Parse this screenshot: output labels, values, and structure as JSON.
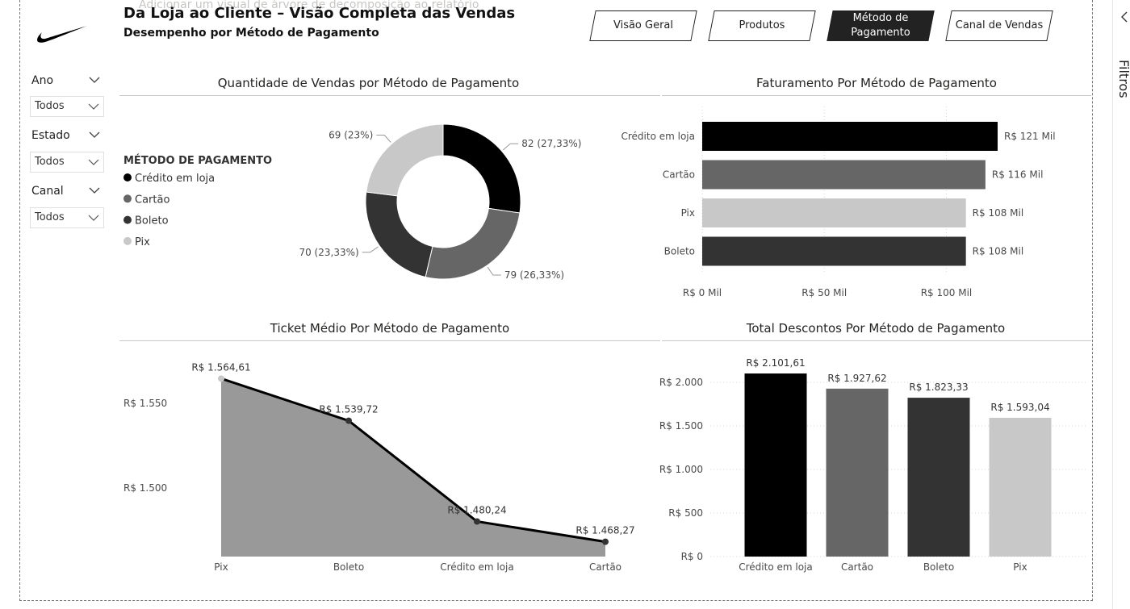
{
  "header": {
    "title": "Da Loja ao Cliente – Visão Completa das Vendas",
    "subtitle": "Desempenho por Método de Pagamento",
    "ghost_hint": "Adicionar um visual de árvore de decomposição ao relatório"
  },
  "nav": {
    "buttons": [
      {
        "label": "Visão Geral",
        "active": false
      },
      {
        "label": "Produtos",
        "active": false
      },
      {
        "label": "Método de Pagamento",
        "active": true
      },
      {
        "label": "Canal de Vendas",
        "active": false
      }
    ]
  },
  "slicers": [
    {
      "title": "Ano",
      "value": "Todos"
    },
    {
      "title": "Estado",
      "value": "Todos"
    },
    {
      "title": "Canal",
      "value": "Todos"
    }
  ],
  "filters_pane": {
    "label": "Filtros"
  },
  "colors": {
    "credito": "#000000",
    "cartao": "#666666",
    "boleto": "#333333",
    "pix": "#c8c8c8",
    "area": "#999999"
  },
  "chart_data": [
    {
      "type": "pie",
      "title": "Quantidade de Vendas por Método de Pagamento",
      "legend_title": "MÉTODO DE PAGAMENTO",
      "legend_placement": "left",
      "donut": true,
      "categories": [
        "Crédito em loja",
        "Cartão",
        "Boleto",
        "Pix"
      ],
      "values": [
        82,
        79,
        70,
        69
      ],
      "data_labels": [
        "82 (27,33%)",
        "79 (26,33%)",
        "70 (23,33%)",
        "69 (23%)"
      ]
    },
    {
      "type": "bar",
      "orientation": "horizontal",
      "title": "Faturamento Por Método de Pagamento",
      "categories": [
        "Crédito em loja",
        "Cartão",
        "Pix",
        "Boleto"
      ],
      "values": [
        121,
        116,
        108,
        108
      ],
      "data_labels": [
        "R$ 121 Mil",
        "R$ 116 Mil",
        "R$ 108 Mil",
        "R$ 108 Mil"
      ],
      "xlim": [
        0,
        125
      ],
      "ticks": [
        0,
        50,
        100
      ],
      "tick_labels": [
        "R$ 0 Mil",
        "R$ 50 Mil",
        "R$ 100 Mil"
      ],
      "grid": true
    },
    {
      "type": "area",
      "title": "Ticket Médio Por Método de Pagamento",
      "categories": [
        "Pix",
        "Boleto",
        "Crédito em loja",
        "Cartão"
      ],
      "values": [
        1564.61,
        1539.72,
        1480.24,
        1468.27
      ],
      "data_labels": [
        "R$ 1.564,61",
        "R$ 1.539,72",
        "R$ 1.480,24",
        "R$ 1.468,27"
      ],
      "ylim": [
        1460,
        1580
      ],
      "ticks": [
        1500,
        1550
      ],
      "tick_labels": [
        "R$ 1.500",
        "R$ 1.550"
      ]
    },
    {
      "type": "bar",
      "orientation": "vertical",
      "title": "Total Descontos Por Método de Pagamento",
      "categories": [
        "Crédito em loja",
        "Cartão",
        "Boleto",
        "Pix"
      ],
      "values": [
        2101.61,
        1927.62,
        1823.33,
        1593.04
      ],
      "data_labels": [
        "R$ 2.101,61",
        "R$ 1.927,62",
        "R$ 1.823,33",
        "R$ 1.593,04"
      ],
      "ylim": [
        0,
        2100
      ],
      "ticks": [
        0,
        500,
        1000,
        1500,
        2000
      ],
      "tick_labels": [
        "R$ 0",
        "R$ 500",
        "R$ 1.000",
        "R$ 1.500",
        "R$ 2.000"
      ],
      "grid": true
    }
  ]
}
